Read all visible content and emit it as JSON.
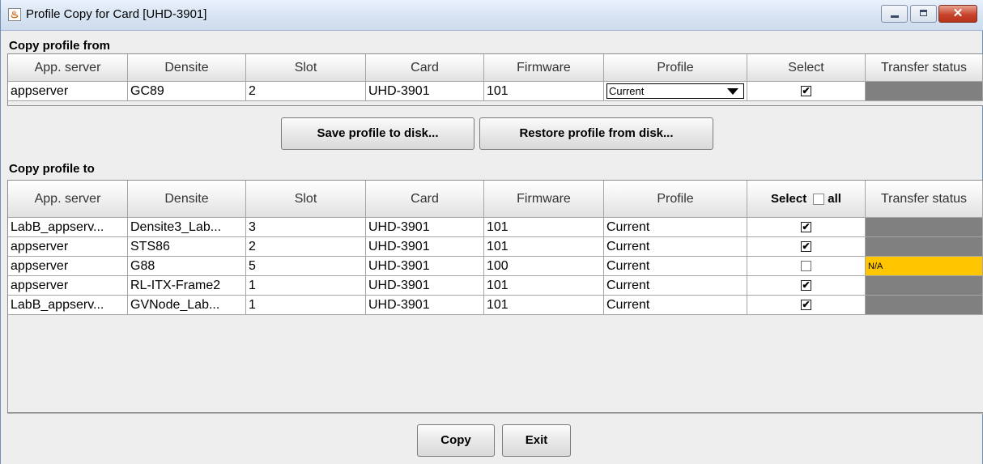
{
  "window": {
    "title": "Profile Copy for Card [UHD-3901]"
  },
  "copy_from": {
    "label": "Copy profile from",
    "columns": [
      "App. server",
      "Densite",
      "Slot",
      "Card",
      "Firmware",
      "Profile",
      "Select",
      "Transfer status"
    ],
    "row": {
      "app_server": "appserver",
      "densite": "GC89",
      "slot": "2",
      "card": "UHD-3901",
      "firmware": "101",
      "profile": "Current",
      "selected": true,
      "transfer_status": ""
    }
  },
  "buttons": {
    "save": "Save profile to disk...",
    "restore": "Restore profile from disk...",
    "copy": "Copy",
    "exit": "Exit"
  },
  "copy_to": {
    "label": "Copy profile to",
    "columns": [
      "App. server",
      "Densite",
      "Slot",
      "Card",
      "Firmware",
      "Profile",
      "Select",
      "Transfer status"
    ],
    "select_all_label": "all",
    "rows": [
      {
        "app_server": "LabB_appserv...",
        "densite": "Densite3_Lab...",
        "slot": "3",
        "card": "UHD-3901",
        "firmware": "101",
        "profile": "Current",
        "selected": true,
        "transfer_status": ""
      },
      {
        "app_server": "appserver",
        "densite": "STS86",
        "slot": "2",
        "card": "UHD-3901",
        "firmware": "101",
        "profile": "Current",
        "selected": true,
        "transfer_status": ""
      },
      {
        "app_server": "appserver",
        "densite": "G88",
        "slot": "5",
        "card": "UHD-3901",
        "firmware": "100",
        "profile": "Current",
        "selected": false,
        "transfer_status": "N/A"
      },
      {
        "app_server": "appserver",
        "densite": "RL-ITX-Frame2",
        "slot": "1",
        "card": "UHD-3901",
        "firmware": "101",
        "profile": "Current",
        "selected": true,
        "transfer_status": ""
      },
      {
        "app_server": "LabB_appserv...",
        "densite": "GVNode_Lab...",
        "slot": "1",
        "card": "UHD-3901",
        "firmware": "101",
        "profile": "Current",
        "selected": true,
        "transfer_status": ""
      }
    ]
  },
  "colors": {
    "status_idle": "#808080",
    "status_na": "#ffc600"
  }
}
